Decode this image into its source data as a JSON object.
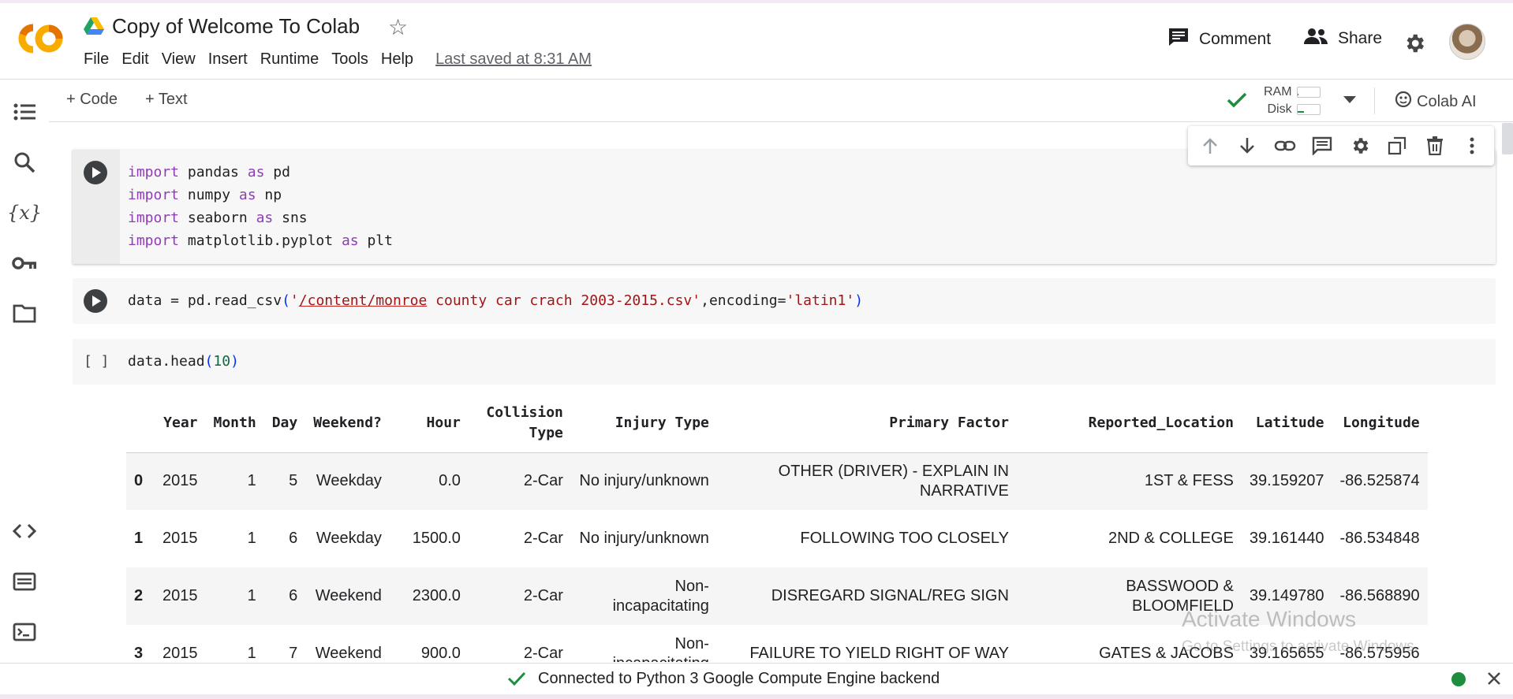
{
  "header": {
    "title": "Copy of Welcome To Colab",
    "menu": [
      "File",
      "Edit",
      "View",
      "Insert",
      "Runtime",
      "Tools",
      "Help"
    ],
    "last_saved": "Last saved at 8:31 AM",
    "comment_label": "Comment",
    "share_label": "Share",
    "logo_text": "CO"
  },
  "toolbar": {
    "add_code": "+ Code",
    "add_text": "+ Text",
    "ram_label": "RAM",
    "disk_label": "Disk",
    "colab_ai": "Colab AI",
    "ram_usage": 0.05,
    "disk_usage": 0.3
  },
  "rail": {
    "icons": [
      "toc-icon",
      "search-icon",
      "variables-icon",
      "secrets-key-icon",
      "folder-icon",
      "code-snippets-icon",
      "command-palette-icon",
      "terminal-icon"
    ]
  },
  "cells": [
    {
      "type": "code",
      "lines": [
        "import pandas as pd",
        "import numpy as np",
        "import seaborn as sns",
        "import matplotlib.pyplot as plt"
      ]
    },
    {
      "type": "code",
      "text": "data = pd.read_csv('/content/monroe county car crach 2003-2015.csv',encoding='latin1')"
    },
    {
      "type": "code",
      "bracket": "[ ]",
      "text": "data.head(10)"
    }
  ],
  "dataframe": {
    "columns": [
      "",
      "Year",
      "Month",
      "Day",
      "Weekend?",
      "Hour",
      "Collision Type",
      "Injury Type",
      "Primary Factor",
      "Reported_Location",
      "Latitude",
      "Longitude"
    ],
    "rows": [
      [
        "0",
        "2015",
        "1",
        "5",
        "Weekday",
        "0.0",
        "2-Car",
        "No injury/unknown",
        "OTHER (DRIVER) - EXPLAIN IN NARRATIVE",
        "1ST & FESS",
        "39.159207",
        "-86.525874"
      ],
      [
        "1",
        "2015",
        "1",
        "6",
        "Weekday",
        "1500.0",
        "2-Car",
        "No injury/unknown",
        "FOLLOWING TOO CLOSELY",
        "2ND & COLLEGE",
        "39.161440",
        "-86.534848"
      ],
      [
        "2",
        "2015",
        "1",
        "6",
        "Weekend",
        "2300.0",
        "2-Car",
        "Non-incapacitating",
        "DISREGARD SIGNAL/REG SIGN",
        "BASSWOOD & BLOOMFIELD",
        "39.149780",
        "-86.568890"
      ],
      [
        "3",
        "2015",
        "1",
        "7",
        "Weekend",
        "900.0",
        "2-Car",
        "Non-incapacitating",
        "FAILURE TO YIELD RIGHT OF WAY",
        "GATES & JACOBS",
        "39.165655",
        "-86.575956"
      ]
    ]
  },
  "watermark": {
    "line1": "Activate Windows",
    "line2": "Go to Settings to activate Windows."
  },
  "status": {
    "text": "Connected to Python 3 Google Compute Engine backend"
  },
  "colors": {
    "accent_orange": "#f9ab00",
    "status_green": "#1e8e3e",
    "keyword_purple": "#8f3db5",
    "string_red": "#a31515"
  }
}
